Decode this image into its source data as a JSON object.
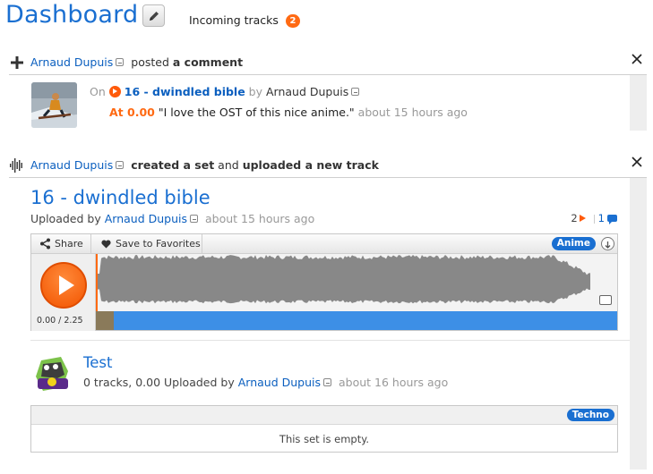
{
  "header": {
    "title": "Dashboard",
    "edit_icon": "pencil-icon",
    "incoming_label": "Incoming tracks",
    "incoming_count": "2"
  },
  "activity_comment": {
    "user": "Arnaud Dupuis",
    "verb": "posted",
    "object": "a comment",
    "on": "On",
    "track_title": "16 - dwindled bible",
    "by": "by",
    "track_user": "Arnaud Dupuis",
    "at_label": "At 0.00",
    "quote": "\"I love the OST of this nice anime.\"",
    "time": "about 15 hours ago"
  },
  "activity_set": {
    "user": "Arnaud Dupuis",
    "verb1": "created a set",
    "and": "and",
    "verb2": "uploaded a new track",
    "track": {
      "title": "16 - dwindled bible",
      "uploaded_by": "Uploaded by",
      "user": "Arnaud Dupuis",
      "time": "about 15 hours ago",
      "plays": "2",
      "comments": "1",
      "share_label": "Share",
      "favorite_label": "Save to Favorites",
      "tag": "Anime",
      "time_position": "0.00 / 2.25",
      "progress_fraction": 0.0
    },
    "set": {
      "title": "Test",
      "meta_prefix": "0 tracks, 0.00 Uploaded by",
      "user": "Arnaud Dupuis",
      "time": "about 16 hours ago",
      "tag": "Techno",
      "empty_message": "This set is empty."
    }
  },
  "colors": {
    "link": "#0b5fbf",
    "accent_orange": "#ff6a13",
    "tag_blue": "#1a6fd1"
  }
}
